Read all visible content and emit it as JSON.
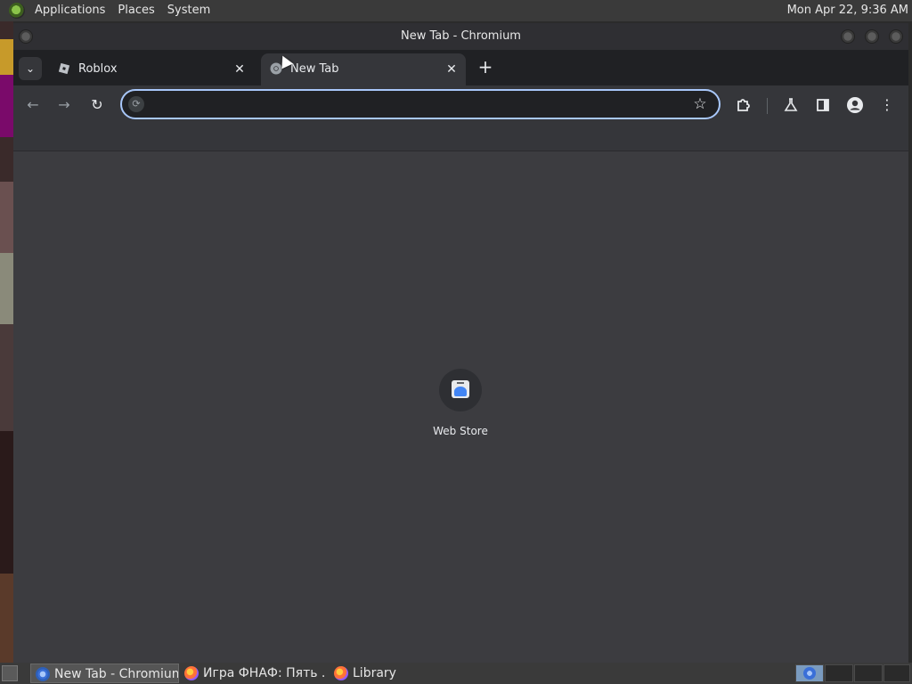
{
  "top_panel": {
    "menu": [
      "Applications",
      "Places",
      "System"
    ],
    "clock": "Mon Apr 22,  9:36 AM"
  },
  "window": {
    "title": "New Tab - Chromium"
  },
  "tabs": [
    {
      "label": "Roblox",
      "favicon": "roblox-icon",
      "active": false
    },
    {
      "label": "New Tab",
      "favicon": "chromium-icon",
      "active": true
    }
  ],
  "toolbar": {
    "back_icon": "arrow-left-icon",
    "forward_icon": "arrow-right-icon",
    "reload_icon": "reload-icon",
    "omnibox_value": "",
    "bookmark_icon": "star-icon",
    "extensions_icon": "puzzle-icon",
    "labs_icon": "flask-icon",
    "side_panel_icon": "side-panel-icon",
    "profile_icon": "profile-icon",
    "menu_icon": "more-vert-icon"
  },
  "new_tab_page": {
    "shortcuts": [
      {
        "label": "Web Store",
        "icon": "web-store-icon"
      }
    ]
  },
  "taskbar": {
    "tasks": [
      {
        "label": "New Tab - Chromium",
        "icon": "chromium-icon",
        "active": true
      },
      {
        "label": "Игра ФНАФ: Пять ...",
        "icon": "firefox-icon",
        "active": false
      },
      {
        "label": "Library",
        "icon": "firefox-icon",
        "active": false
      }
    ]
  },
  "colors": {
    "accent_focus_ring": "#a8c7fa",
    "tab_strip": "#202124",
    "toolbar": "#35363a",
    "ntp_background": "#3c3c40"
  }
}
